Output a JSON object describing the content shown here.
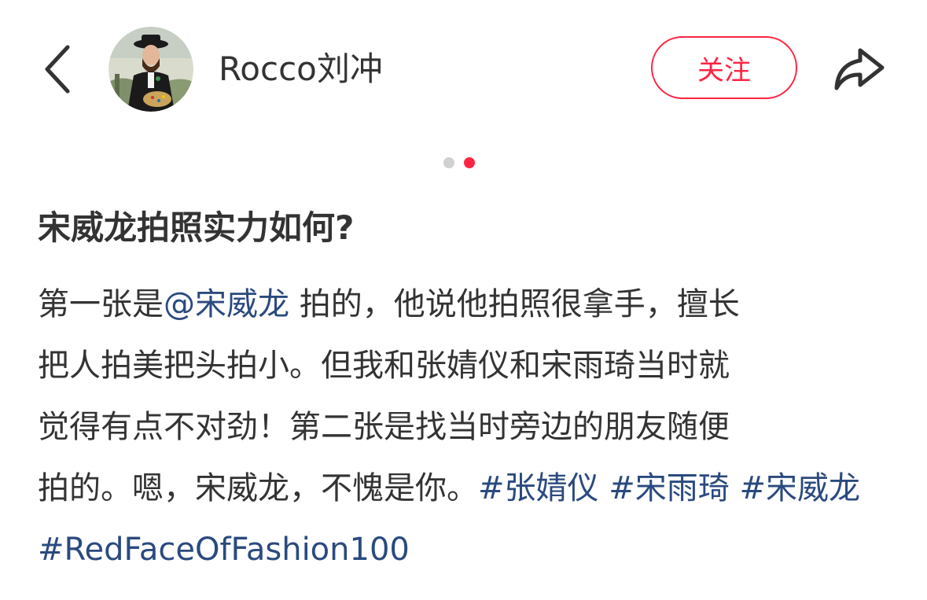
{
  "header": {
    "author_name": "Rocco刘冲",
    "follow_label": "关注"
  },
  "carousel": {
    "current_index": 2,
    "total": 2
  },
  "note": {
    "title": "宋威龙拍照实力如何?",
    "body": {
      "line1_prefix": "第一张是",
      "mention": "@宋威龙",
      "line1_suffix": " 拍的，他说他拍照很拿手，擅长",
      "line2": "把人拍美把头拍小。但我和张婧仪和宋雨琦当时就",
      "line3": "觉得有点不对劲！第二张是找当时旁边的朋友随便",
      "line4_prefix": "拍的。嗯，宋威龙，不愧是你。",
      "tags": [
        "#张婧仪",
        "#宋雨琦",
        "#宋威龙",
        "#RedFaceOfFashion100"
      ]
    }
  },
  "colors": {
    "accent": "#ff2442",
    "link": "#2a4a7f",
    "text": "#333333",
    "dot_inactive": "#d0d0d0"
  },
  "icons": {
    "back": "chevron-left-icon",
    "share": "share-arrow-icon"
  }
}
